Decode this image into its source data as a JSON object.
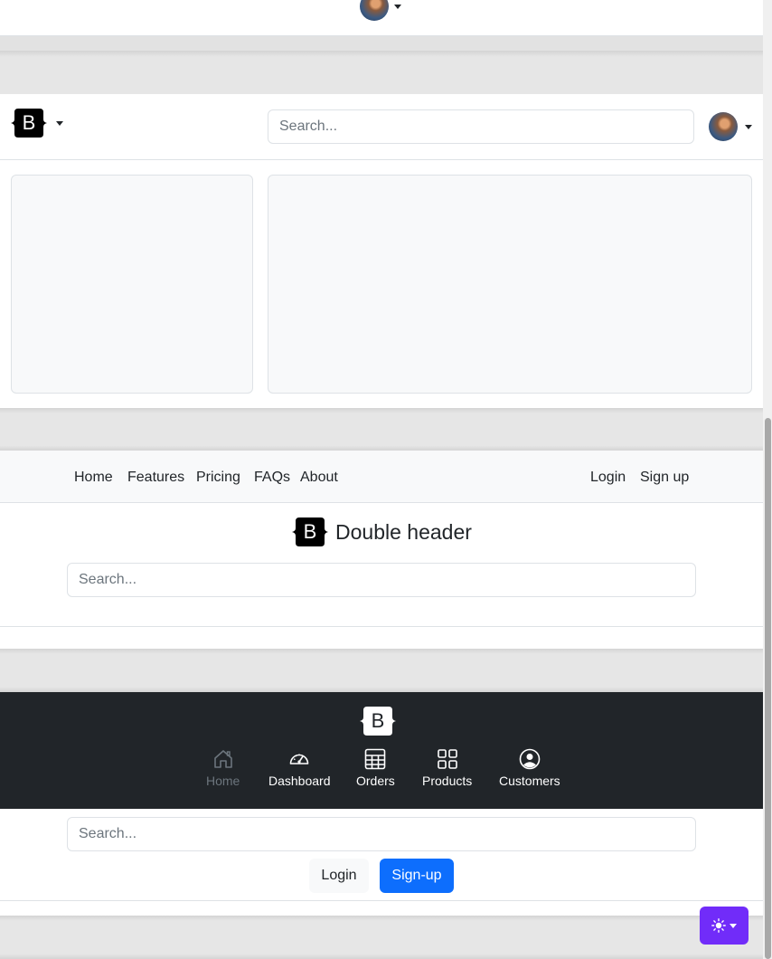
{
  "header_avatar": {
    "icon": "user-avatar"
  },
  "app_header": {
    "search_placeholder": "Search...",
    "logo_letter": "B"
  },
  "double_header": {
    "nav_left": [
      {
        "label": "Home"
      },
      {
        "label": "Features"
      },
      {
        "label": "Pricing"
      },
      {
        "label": "FAQs"
      },
      {
        "label": "About"
      }
    ],
    "nav_right": [
      {
        "label": "Login"
      },
      {
        "label": "Sign up"
      }
    ],
    "logo_letter": "B",
    "title": "Double header",
    "search_placeholder": "Search..."
  },
  "dark_header": {
    "logo_letter": "B",
    "nav": [
      {
        "label": "Home",
        "icon": "home-icon",
        "active": false
      },
      {
        "label": "Dashboard",
        "icon": "speedometer-icon",
        "active": true
      },
      {
        "label": "Orders",
        "icon": "table-icon",
        "active": true
      },
      {
        "label": "Products",
        "icon": "grid-icon",
        "active": true
      },
      {
        "label": "Customers",
        "icon": "person-circle-icon",
        "active": true
      }
    ],
    "search_placeholder": "Search...",
    "login_label": "Login",
    "signup_label": "Sign-up"
  },
  "theme_toggle": {
    "icon": "sun-icon",
    "color": "#712cf9"
  },
  "colors": {
    "primary": "#0d6efd",
    "dark": "#212529",
    "light": "#f8f9fa",
    "border": "#dee2e6"
  }
}
